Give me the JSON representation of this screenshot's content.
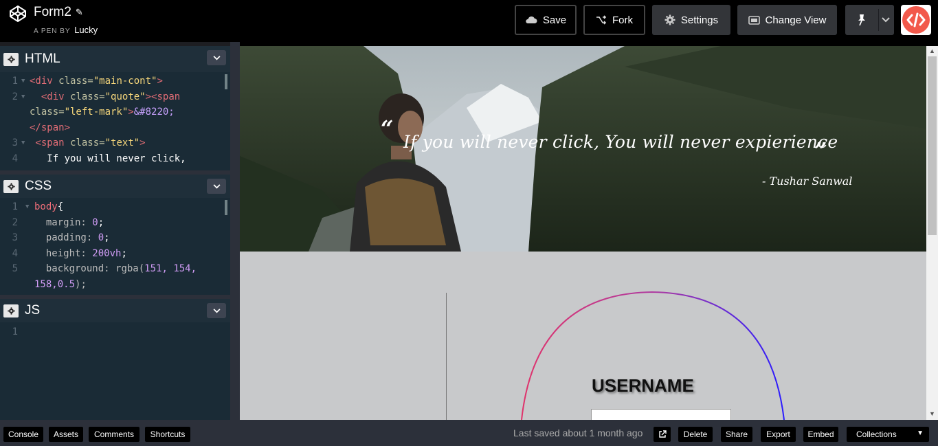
{
  "header": {
    "pen_title": "Form2",
    "pen_by_prefix": "A PEN BY",
    "author": "Lucky",
    "buttons": {
      "save": "Save",
      "fork": "Fork",
      "settings": "Settings",
      "change_view": "Change View"
    }
  },
  "editors": {
    "html": {
      "title": "HTML",
      "lines": [
        {
          "n": "1",
          "fold": true
        },
        {
          "n": "2",
          "fold": true
        },
        {
          "n": "",
          "fold": false
        },
        {
          "n": "",
          "fold": false
        },
        {
          "n": "3",
          "fold": true
        },
        {
          "n": "4",
          "fold": false
        }
      ]
    },
    "css": {
      "title": "CSS",
      "lines": [
        {
          "n": "1"
        },
        {
          "n": "2"
        },
        {
          "n": "3"
        },
        {
          "n": "4"
        },
        {
          "n": "5"
        },
        {
          "n": ""
        }
      ]
    },
    "js": {
      "title": "JS",
      "lines": [
        {
          "n": "1"
        }
      ]
    }
  },
  "code_html": {
    "l1_tag": "<div ",
    "l1_attr": "class=",
    "l1_str": "\"main-cont\"",
    "l1_end": ">",
    "l2_tag": "  <div ",
    "l2_attr": "class=",
    "l2_str": "\"quote\"",
    "l2_end": "><span",
    "l3_attr": "class=",
    "l3_str": "\"left-mark\"",
    "l3_end": ">",
    "l3_ent": "&#8220;",
    "l4_tag": "</span>",
    "l5_tag": " <span ",
    "l5_attr": "class=",
    "l5_str": "\"text\"",
    "l5_end": ">",
    "l6_text": "   If you will never click,"
  },
  "code_css": {
    "l1_sel": "body",
    "l1_brace": "{",
    "l2_prop": "  margin: ",
    "l2_val": "0",
    "l3_prop": "  padding: ",
    "l3_val": "0",
    "l4_prop": "  height: ",
    "l4_val": "200vh",
    "l5_prop": "  background: ",
    "l5_fn": "rgba(",
    "l5_val": "151, 154,",
    "l6_val": "158,0.5",
    "l6_end": ");"
  },
  "preview": {
    "open_quote": "“",
    "quote_text": "If you will never click, You will never expierience",
    "close_quote": "”",
    "author": "- Tushar Sanwal",
    "username_label": "USERNAME"
  },
  "footer": {
    "console": "Console",
    "assets": "Assets",
    "comments": "Comments",
    "shortcuts": "Shortcuts",
    "last_saved": "Last saved about 1 month ago",
    "delete": "Delete",
    "share": "Share",
    "export": "Export",
    "embed": "Embed",
    "collections": "Collections"
  },
  "colors": {
    "accent": "#f2594b",
    "editor_bg": "#1a2b36",
    "preview_bg": "#c8c9cb"
  }
}
